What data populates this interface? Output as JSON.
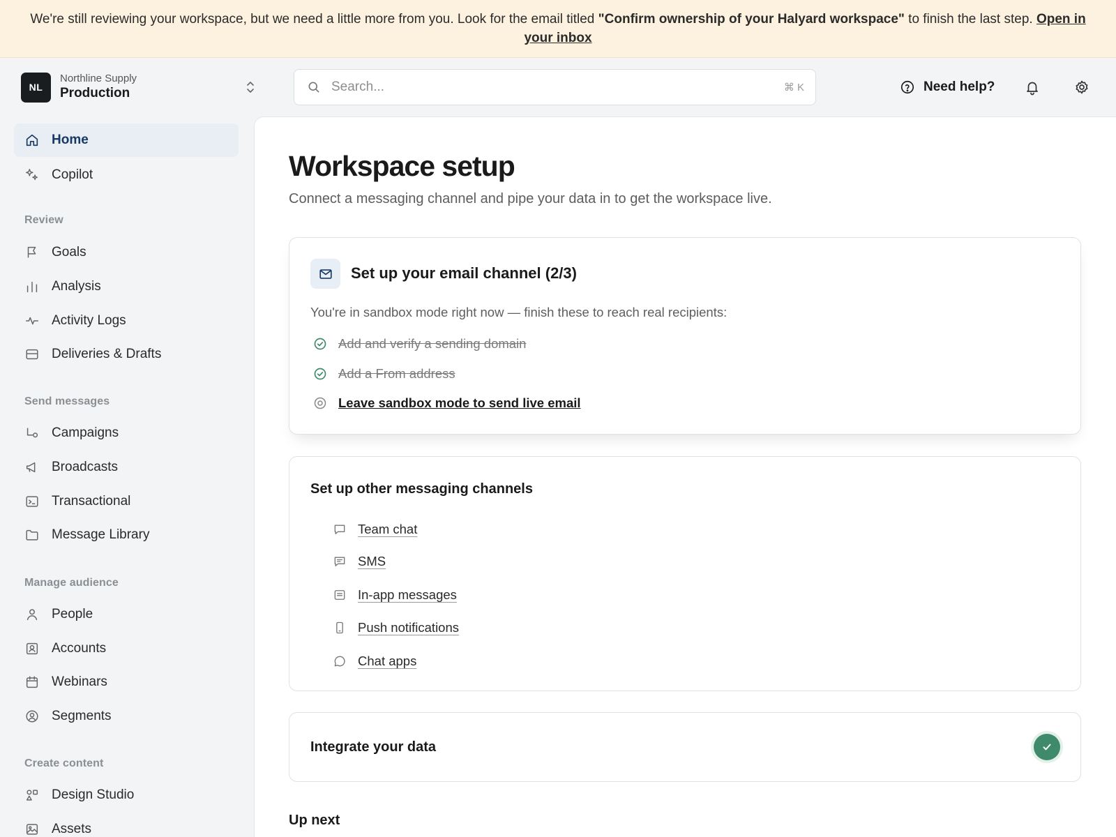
{
  "banner": {
    "text_before": "We're still reviewing your workspace, but we need a little more from you. Look for the email titled ",
    "email_title": "\"Confirm ownership of your Halyard workspace\"",
    "text_after": " to finish the last step. ",
    "link": "Open in your inbox"
  },
  "workspace": {
    "logo": "NL",
    "org": "Northline Supply",
    "env": "Production"
  },
  "nav": {
    "home": "Home",
    "copilot": "Copilot",
    "review_header": "Review",
    "goals": "Goals",
    "analysis": "Analysis",
    "activity_logs": "Activity Logs",
    "deliveries": "Deliveries & Drafts",
    "send_header": "Send messages",
    "campaigns": "Campaigns",
    "broadcasts": "Broadcasts",
    "transactional": "Transactional",
    "message_library": "Message Library",
    "audience_header": "Manage audience",
    "people": "People",
    "accounts": "Accounts",
    "webinars": "Webinars",
    "segments": "Segments",
    "content_header": "Create content",
    "design_studio": "Design Studio",
    "assets": "Assets"
  },
  "topbar": {
    "search_placeholder": "Search...",
    "shortcut": "⌘ K",
    "help": "Need help?"
  },
  "page": {
    "title": "Workspace setup",
    "subtitle": "Connect a messaging channel and pipe your data in to get the workspace live."
  },
  "email_card": {
    "title": "Set up your email channel (2/3)",
    "description": "You're in sandbox mode right now — finish these to reach real recipients:",
    "tasks": [
      {
        "label": "Add and verify a sending domain",
        "done": true
      },
      {
        "label": "Add a From address",
        "done": true
      },
      {
        "label": "Leave sandbox mode to send live email",
        "done": false
      }
    ]
  },
  "channels_card": {
    "title": "Set up other messaging channels",
    "channels": [
      "Team chat",
      "SMS",
      "In-app messages",
      "Push notifications",
      "Chat apps"
    ]
  },
  "data_card": {
    "title": "Integrate your data",
    "complete": true
  },
  "up_next": "Up next",
  "colors": {
    "accent": "#163a63",
    "success": "#3f8a6a",
    "banner_bg": "#fdf2df"
  }
}
